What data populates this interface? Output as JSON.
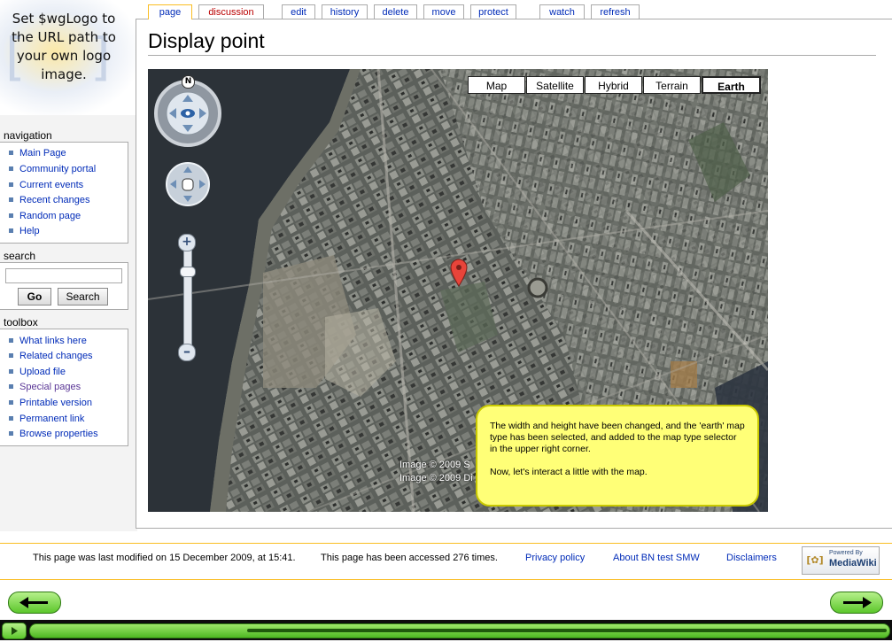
{
  "logo": {
    "placeholder_text": "Set $wgLogo to the URL path to your own logo image."
  },
  "sidebar": {
    "navigation": {
      "title": "navigation",
      "items": [
        "Main Page",
        "Community portal",
        "Current events",
        "Recent changes",
        "Random page",
        "Help"
      ]
    },
    "search": {
      "title": "search",
      "input_value": "",
      "go_label": "Go",
      "search_label": "Search"
    },
    "toolbox": {
      "title": "toolbox",
      "items": [
        "What links here",
        "Related changes",
        "Upload file",
        "Special pages",
        "Printable version",
        "Permanent link",
        "Browse properties"
      ]
    }
  },
  "tabs": {
    "page": "page",
    "discussion": "discussion",
    "edit": "edit",
    "history": "history",
    "delete": "delete",
    "move": "move",
    "protect": "protect",
    "watch": "watch",
    "refresh": "refresh",
    "selected": "page"
  },
  "page_title": "Display point",
  "map": {
    "compass_label": "N",
    "map_types": [
      "Map",
      "Satellite",
      "Hybrid",
      "Terrain",
      "Earth"
    ],
    "selected_type": "Earth",
    "zoom_level": 0.72,
    "copyright_lines": [
      "Image © 2009 S",
      "Image © 2009 Di"
    ],
    "tooltip": {
      "paragraph1": "The width and height have been changed, and the 'earth' map type has been selected, and added to the map type selector in the upper right corner.",
      "paragraph2": "Now, let's interact a little with the map."
    }
  },
  "footer": {
    "last_modified": "This page was last modified on 15 December 2009, at 15:41.",
    "accessed": "This page has been accessed 276 times.",
    "privacy": "Privacy policy",
    "about": "About BN test SMW",
    "disclaimers": "Disclaimers",
    "powered_by_top": "Powered By",
    "powered_by_bottom": "MediaWiki"
  },
  "player": {
    "progress": 0.25
  },
  "colors": {
    "link": "#002bb8",
    "tab_selected_border": "#fabd23",
    "tooltip_bg": "#ffff77",
    "arrow_green": "#5cc72c"
  }
}
